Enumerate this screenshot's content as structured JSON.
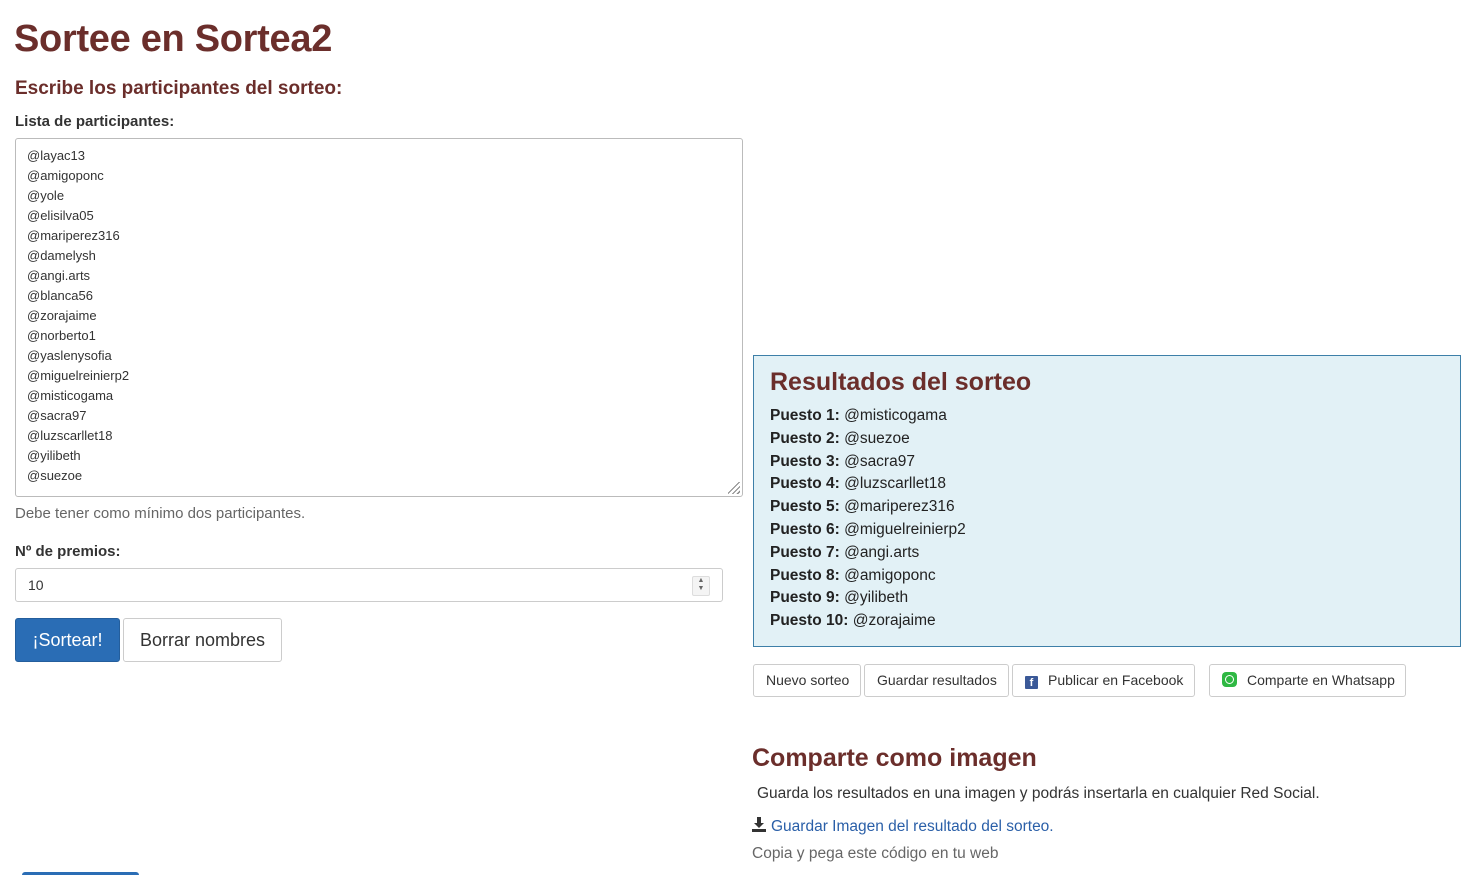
{
  "header": {
    "title": "Sortee en Sortea2",
    "subtitle": "Escribe los participantes del sorteo:"
  },
  "form": {
    "participants_label": "Lista de participantes:",
    "participants": [
      "@layac13",
      "@amigoponc",
      "@yole",
      "@elisilva05",
      "@mariperez316",
      "@damelysh",
      "@angi.arts",
      "@blanca56",
      "@zorajaime",
      "@norberto1",
      "@yaslenysofia",
      "@miguelreinierp2",
      "@misticogama",
      "@sacra97",
      "@luzscarllet18",
      "@yilibeth",
      "@suezoe"
    ],
    "help_text": "Debe tener como mínimo dos participantes.",
    "prizes_label": "Nº de premios:",
    "prizes_value": "10",
    "draw_button": "¡Sortear!",
    "clear_button": "Borrar nombres"
  },
  "results": {
    "title": "Resultados del sorteo",
    "items": [
      {
        "label": "Puesto 1:",
        "winner": "@misticogama"
      },
      {
        "label": "Puesto 2:",
        "winner": "@suezoe"
      },
      {
        "label": "Puesto 3:",
        "winner": "@sacra97"
      },
      {
        "label": "Puesto 4:",
        "winner": "@luzscarllet18"
      },
      {
        "label": "Puesto 5:",
        "winner": "@mariperez316"
      },
      {
        "label": "Puesto 6:",
        "winner": "@miguelreinierp2"
      },
      {
        "label": "Puesto 7:",
        "winner": "@angi.arts"
      },
      {
        "label": "Puesto 8:",
        "winner": "@amigoponc"
      },
      {
        "label": "Puesto 9:",
        "winner": "@yilibeth"
      },
      {
        "label": "Puesto 10:",
        "winner": "@zorajaime"
      }
    ]
  },
  "actions": {
    "new_draw": "Nuevo sorteo",
    "save_results": "Guardar resultados",
    "facebook": "Publicar en Facebook",
    "whatsapp": "Comparte en Whatsapp"
  },
  "share": {
    "title": "Comparte como imagen",
    "text": "Guarda los resultados en una imagen y podrás insertarla en cualquier Red Social.",
    "download_link": "Guardar Imagen del resultado del sorteo.",
    "copy_text": "Copia y pega este código en tu web"
  },
  "icons": {
    "facebook": "facebook-icon",
    "whatsapp": "whatsapp-icon",
    "download": "download-icon"
  },
  "colors": {
    "heading": "#6b2e2b",
    "primary": "#2a6db5",
    "results_bg": "#e2f1f6",
    "results_border": "#3d7fa8",
    "link": "#2a5fa8"
  }
}
